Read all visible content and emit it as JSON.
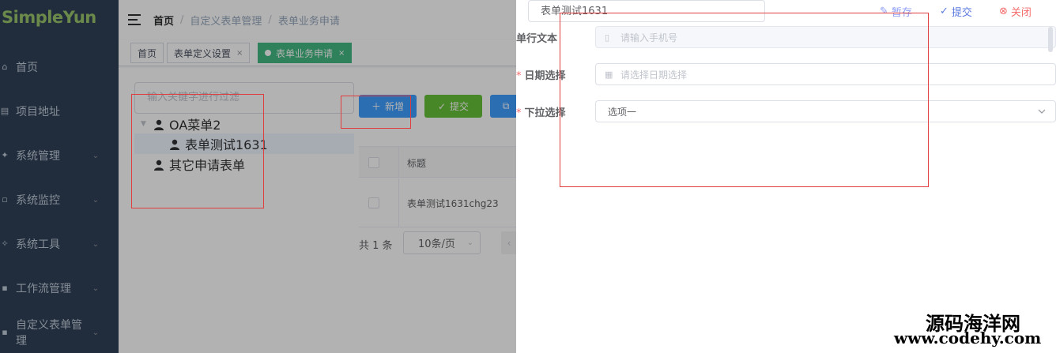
{
  "sidebar": {
    "logo": "SimpleYun",
    "items": [
      {
        "label": "首页",
        "icon": "home-icon",
        "arrow": false
      },
      {
        "label": "项目地址",
        "icon": "link-icon",
        "arrow": false
      },
      {
        "label": "系统管理",
        "icon": "settings-icon",
        "arrow": true
      },
      {
        "label": "系统监控",
        "icon": "monitor-icon",
        "arrow": true
      },
      {
        "label": "系统工具",
        "icon": "tool-icon",
        "arrow": true
      },
      {
        "label": "工作流管理",
        "icon": "workflow-icon",
        "arrow": true
      },
      {
        "label": "自定义表单管理",
        "icon": "form-icon",
        "arrow": true
      }
    ]
  },
  "navbar": {
    "breadcrumb": [
      "首页",
      "自定义表单管理",
      "表单业务申请"
    ],
    "separator": "/"
  },
  "tags": [
    {
      "label": "首页",
      "active": false,
      "closable": false
    },
    {
      "label": "表单定义设置",
      "active": false,
      "closable": true
    },
    {
      "label": "表单业务申请",
      "active": true,
      "closable": true
    }
  ],
  "tree": {
    "filter_placeholder": "输入关键字进行过滤",
    "nodes": [
      "OA菜单2",
      "表单测试1631",
      "其它申请表单"
    ]
  },
  "toolbar": {
    "add_label": "新增",
    "submit_label": "提交"
  },
  "table": {
    "header_title": "标题",
    "rows": [
      {
        "title": "表单测试1631chg23"
      }
    ]
  },
  "pagination": {
    "total_text": "共 1 条",
    "page_size": "10条/页"
  },
  "drawer": {
    "form_name": "表单测试1631",
    "actions": {
      "save": "暂存",
      "submit": "提交",
      "close": "关闭"
    },
    "fields": [
      {
        "label": "单行文本",
        "required": false,
        "placeholder": "请输入手机号",
        "value": "",
        "disabled": true
      },
      {
        "label": "日期选择",
        "required": true,
        "placeholder": "请选择日期选择",
        "value": "",
        "disabled": false
      },
      {
        "label": "下拉选择",
        "required": true,
        "placeholder": "",
        "value": "选项一",
        "disabled": false
      }
    ]
  },
  "watermark": {
    "line1": "源码海洋网",
    "line2": "www.codehy.com"
  },
  "colors": {
    "sidebar_bg": "#304156",
    "logo": "#99c56a",
    "primary": "#409eff",
    "success": "#67c23a",
    "active_tag": "#42b983",
    "danger": "#f56c6c",
    "annotation": "#e03e3e"
  }
}
